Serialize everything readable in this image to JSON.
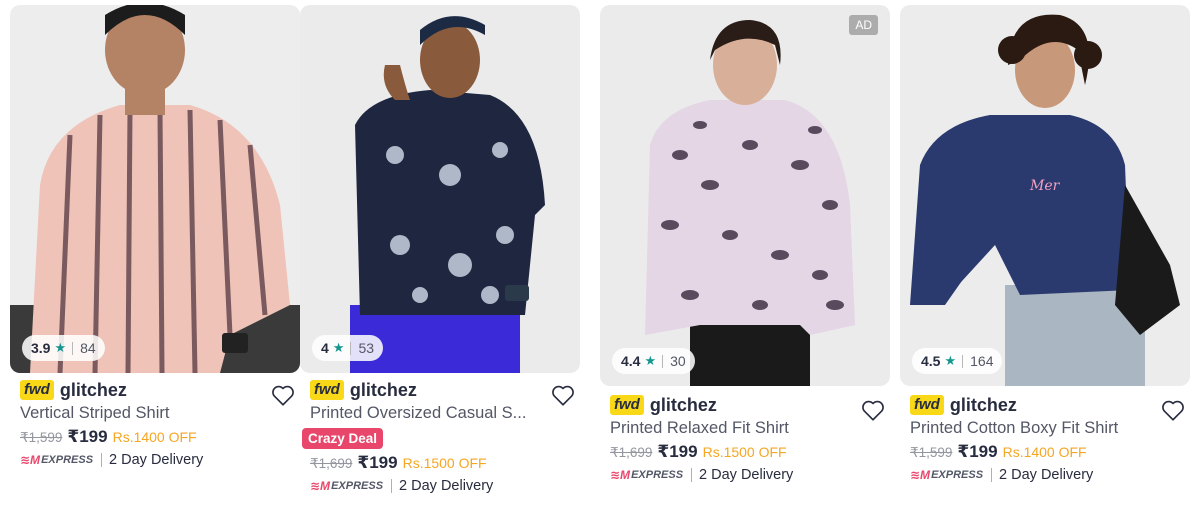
{
  "products": [
    {
      "brand_badge": "fwd",
      "brand": "glitchez",
      "title": "Vertical Striped Shirt",
      "rating": "3.9",
      "rating_count": "84",
      "mrp": "₹1,599",
      "price": "₹199",
      "discount": "Rs.1400 OFF",
      "express_label": "EXPRESS",
      "delivery": "2 Day Delivery",
      "badge": null,
      "ad": null,
      "image": "pink-striped-shirt-model"
    },
    {
      "brand_badge": "fwd",
      "brand": "glitchez",
      "title": "Printed Oversized Casual S...",
      "rating": "4",
      "rating_count": "53",
      "mrp": "₹1,699",
      "price": "₹199",
      "discount": "Rs.1500 OFF",
      "express_label": "EXPRESS",
      "delivery": "2 Day Delivery",
      "badge": "Crazy Deal",
      "ad": null,
      "image": "navy-planet-print-shirt-model"
    },
    {
      "brand_badge": "fwd",
      "brand": "glitchez",
      "title": "Printed Relaxed Fit Shirt",
      "rating": "4.4",
      "rating_count": "30",
      "mrp": "₹1,699",
      "price": "₹199",
      "discount": "Rs.1500 OFF",
      "express_label": "EXPRESS",
      "delivery": "2 Day Delivery",
      "badge": null,
      "ad": "AD",
      "image": "leopard-print-shirt-model"
    },
    {
      "brand_badge": "fwd",
      "brand": "glitchez",
      "title": "Printed Cotton Boxy Fit Shirt",
      "rating": "4.5",
      "rating_count": "164",
      "mrp": "₹1,599",
      "price": "₹199",
      "discount": "Rs.1400 OFF",
      "express_label": "EXPRESS",
      "delivery": "2 Day Delivery",
      "badge": null,
      "ad": null,
      "image": "navy-cropped-shirt-model"
    }
  ],
  "colors": {
    "accent_pink": "#e8466b",
    "discount_orange": "#f5a623",
    "star_teal": "#14958f",
    "fwd_yellow": "#f8d817"
  },
  "icons": [
    "star-icon",
    "heart-icon",
    "express-icon"
  ]
}
